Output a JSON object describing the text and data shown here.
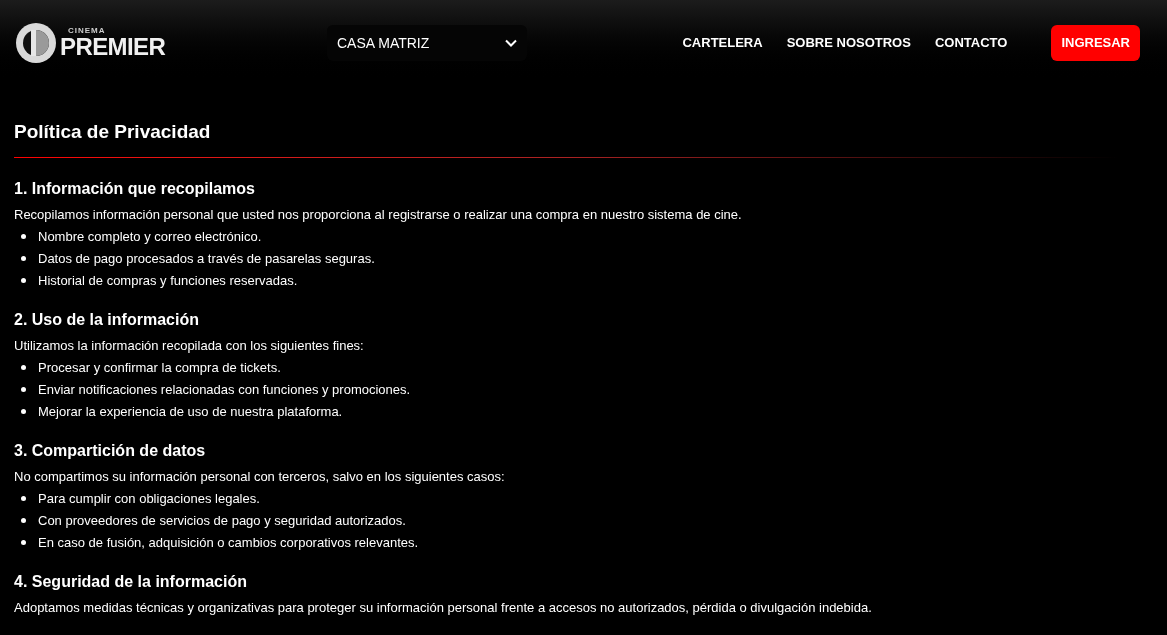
{
  "logo": {
    "small": "CINEMA",
    "name": "PREMIER"
  },
  "branch_select": {
    "value": "CASA MATRIZ"
  },
  "nav": [
    "CARTELERA",
    "SOBRE NOSOTROS",
    "CONTACTO"
  ],
  "login_button": "INGRESAR",
  "title": "Política de Privacidad",
  "sections": [
    {
      "heading": "1. Información que recopilamos",
      "text": "Recopilamos información personal que usted nos proporciona al registrarse o realizar una compra en nuestro sistema de cine.",
      "items": [
        "Nombre completo y correo electrónico.",
        "Datos de pago procesados a través de pasarelas seguras.",
        "Historial de compras y funciones reservadas."
      ]
    },
    {
      "heading": "2. Uso de la información",
      "text": "Utilizamos la información recopilada con los siguientes fines:",
      "items": [
        "Procesar y confirmar la compra de tickets.",
        "Enviar notificaciones relacionadas con funciones y promociones.",
        "Mejorar la experiencia de uso de nuestra plataforma."
      ]
    },
    {
      "heading": "3. Compartición de datos",
      "text": "No compartimos su información personal con terceros, salvo en los siguientes casos:",
      "items": [
        "Para cumplir con obligaciones legales.",
        "Con proveedores de servicios de pago y seguridad autorizados.",
        "En caso de fusión, adquisición o cambios corporativos relevantes."
      ]
    },
    {
      "heading": "4. Seguridad de la información",
      "text": "Adoptamos medidas técnicas y organizativas para proteger su información personal frente a accesos no autorizados, pérdida o divulgación indebida."
    }
  ]
}
